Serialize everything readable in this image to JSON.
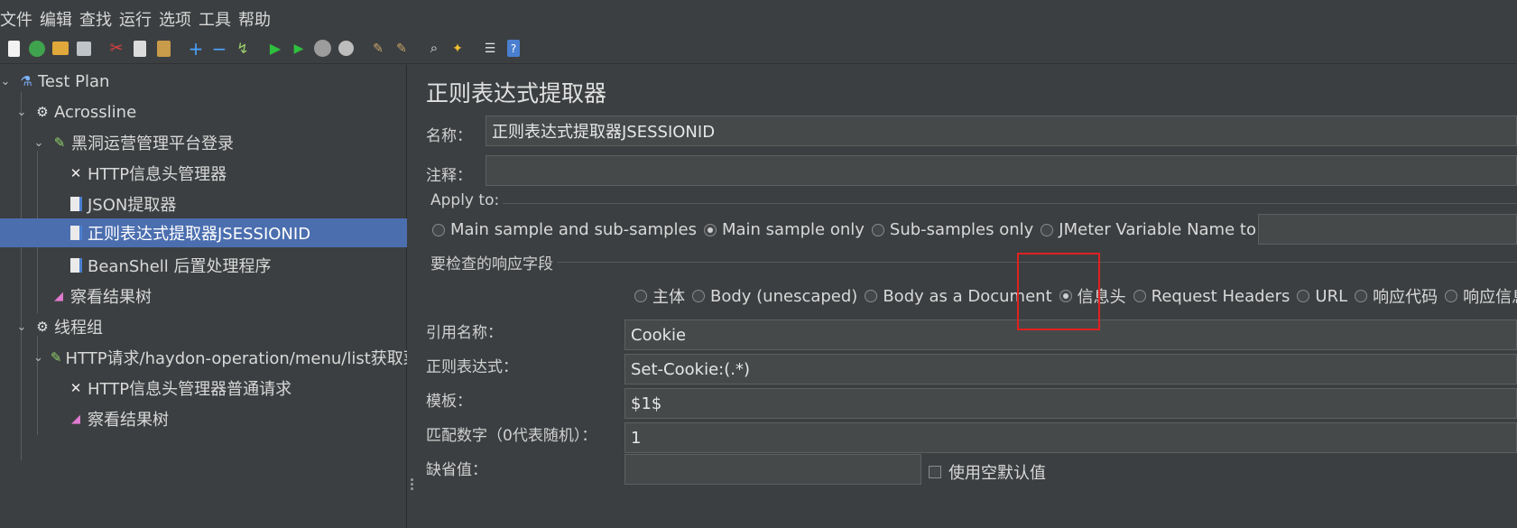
{
  "menubar": {
    "items": [
      "文件",
      "编辑",
      "查找",
      "运行",
      "选项",
      "工具",
      "帮助"
    ]
  },
  "toolbar": {
    "icons": [
      "new-icon",
      "templates-icon",
      "open-icon",
      "save-icon",
      "cut-icon",
      "copy-icon",
      "paste-icon",
      "expand-icon",
      "collapse-icon",
      "toggle-icon",
      "start-icon",
      "start-no-pause-icon",
      "stop-icon",
      "shutdown-icon",
      "clear-icon",
      "clear-all-icon",
      "search-icon",
      "reset-search-icon",
      "function-helper-icon",
      "help-icon"
    ]
  },
  "tree": {
    "nodes": [
      {
        "label": "Test Plan",
        "icon": "flask-icon",
        "expanded": true
      },
      {
        "label": "Acrossline",
        "icon": "gear-icon",
        "expanded": true
      },
      {
        "label": "黑洞运营管理平台登录",
        "icon": "pipette-icon",
        "expanded": true
      },
      {
        "label": "HTTP信息头管理器",
        "icon": "tools-icon"
      },
      {
        "label": "JSON提取器",
        "icon": "document-icon"
      },
      {
        "label": "正则表达式提取器JSESSIONID",
        "icon": "document-icon",
        "selected": true
      },
      {
        "label": "BeanShell 后置处理程序",
        "icon": "document-icon"
      },
      {
        "label": "察看结果树",
        "icon": "chart-icon"
      },
      {
        "label": "线程组",
        "icon": "gear-icon",
        "expanded": true
      },
      {
        "label": "HTTP请求/haydon-operation/menu/list获取菜",
        "icon": "pipette-icon",
        "expanded": true
      },
      {
        "label": "HTTP信息头管理器普通请求",
        "icon": "tools-icon"
      },
      {
        "label": "察看结果树",
        "icon": "chart-icon"
      }
    ]
  },
  "panel": {
    "title": "正则表达式提取器",
    "name_label": "名称：",
    "name_value": "正则表达式提取器JSESSIONID",
    "comment_label": "注释：",
    "comment_value": "",
    "apply_to": {
      "title": "Apply to:",
      "options": [
        "Main sample and sub-samples",
        "Main sample only",
        "Sub-samples only",
        "JMeter Variable Name to use"
      ],
      "selected": "Main sample only",
      "variable_value": ""
    },
    "field_to_check": {
      "title": "要检查的响应字段",
      "options": [
        "主体",
        "Body (unescaped)",
        "Body as a Document",
        "信息头",
        "Request Headers",
        "URL",
        "响应代码",
        "响应信息"
      ],
      "selected": "信息头"
    },
    "ref_name_label": "引用名称：",
    "ref_name_value": "Cookie",
    "regex_label": "正则表达式：",
    "regex_value": "Set-Cookie:(.*)",
    "template_label": "模板：",
    "template_value": "$1$",
    "match_no_label": "匹配数字（0代表随机）：",
    "match_no_value": "1",
    "default_label": "缺省值：",
    "default_value": "",
    "use_empty_default_label": "使用空默认值",
    "use_empty_default_checked": false
  },
  "colors": {
    "background": "#3c3f41",
    "selection": "#4b6eaf",
    "highlight": "#e02020"
  }
}
